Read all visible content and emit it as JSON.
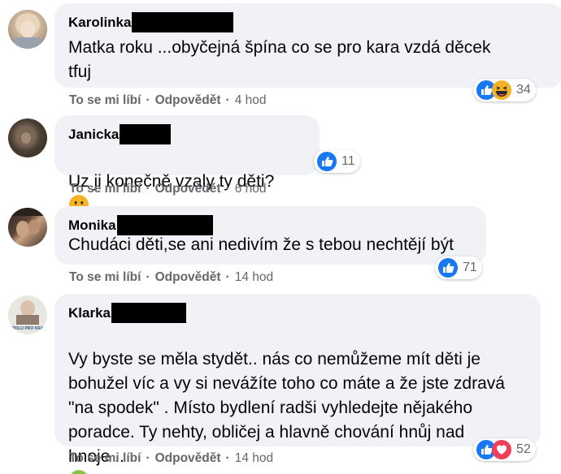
{
  "comments": [
    {
      "author": "Karolinka",
      "text": "Matka roku ...obyčejná špína co se pro kara vzdá děcek\ntfuj",
      "reaction_count": "34",
      "reactions": [
        "like-icon",
        "haha-icon"
      ],
      "like_label": "To se mi líbí",
      "reply_label": "Odpovědět",
      "time": "4 hod"
    },
    {
      "author": "Janicka",
      "text": "Uz ji konečně vzaly ty děti?",
      "reaction_count": "11",
      "reactions": [
        "like-icon"
      ],
      "like_label": "To se mi líbí",
      "reply_label": "Odpovědět",
      "time": "6 hod"
    },
    {
      "author": "Monika",
      "text": "Chudáci děti,se ani nedivím že s tebou nechtějí být",
      "reaction_count": "71",
      "reactions": [
        "like-icon"
      ],
      "like_label": "To se mi líbí",
      "reply_label": "Odpovědět",
      "time": "14 hod"
    },
    {
      "author": "Klarka",
      "avatar_text": "SPOLU PRO KRAJ",
      "text": "Vy byste se měla stydět.. nás co nemůžeme mít děti je\nbohužel víc a vy si nevážíte toho co máte a že jste zdravá\n\"na spodek\" . Místo bydlení radši vyhledejte nějakého\nporadce. Ty nehty, obličej a hlavně chování hnůj nad\nhnoje ..",
      "reaction_count": "52",
      "reactions": [
        "like-icon",
        "love-icon"
      ],
      "like_label": "To se mi líbí",
      "reply_label": "Odpovědět",
      "time": "14 hod"
    }
  ],
  "colors": {
    "bubble": "#f0f2f5",
    "meta": "#65676b",
    "like": "#1877f2",
    "love": "#f33e58",
    "emoji": "#f7b125"
  }
}
